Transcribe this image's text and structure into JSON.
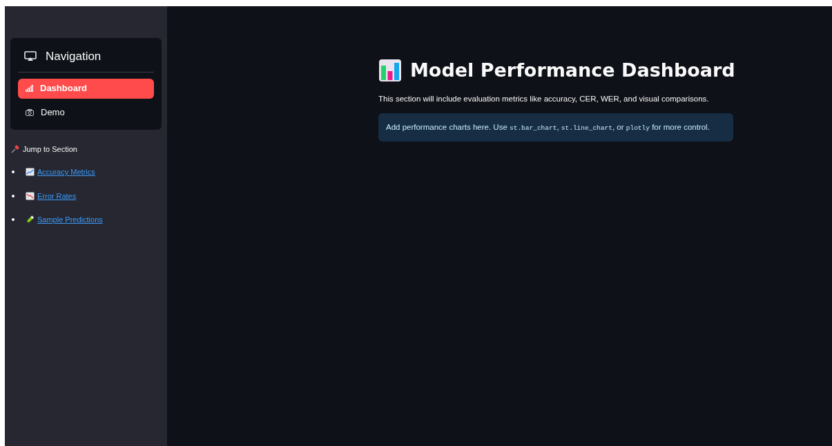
{
  "sidebar": {
    "navigation": {
      "title": "Navigation",
      "items": [
        {
          "label": "Dashboard",
          "selected": true
        },
        {
          "label": "Demo",
          "selected": false
        }
      ]
    },
    "jump": {
      "title": "Jump to Section",
      "links": [
        {
          "label": "Accuracy Metrics"
        },
        {
          "label": "Error Rates"
        },
        {
          "label": "Sample Predictions"
        }
      ]
    }
  },
  "main": {
    "title": "Model Performance Dashboard",
    "description": "This section will include evaluation metrics like accuracy, CER, WER, and visual comparisons.",
    "info": [
      {
        "kind": "text",
        "text": "Add performance charts here. Use "
      },
      {
        "kind": "code",
        "text": "st.bar_chart"
      },
      {
        "kind": "text",
        "text": ", "
      },
      {
        "kind": "code",
        "text": "st.line_chart"
      },
      {
        "kind": "text",
        "text": ", or "
      },
      {
        "kind": "code",
        "text": "plotly"
      },
      {
        "kind": "text",
        "text": " for more control."
      }
    ]
  }
}
